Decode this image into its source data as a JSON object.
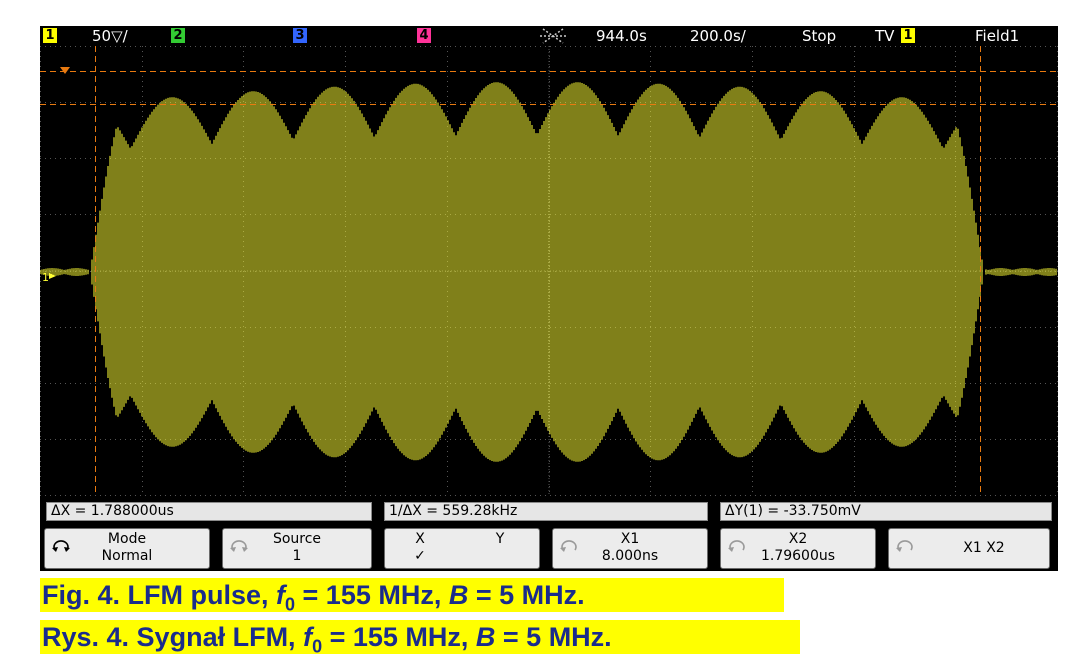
{
  "topbar": {
    "ch1_num": "1",
    "ch1_scale": "50▽/",
    "ch2_num": "2",
    "ch3_num": "3",
    "ch4_num": "4",
    "delay": "944.0s",
    "timebase": "200.0s/",
    "run_state": "Stop",
    "trigger_mode": "TV",
    "trigger_source": "1",
    "trigger_field": "Field1"
  },
  "display": {
    "ground_marker": "1",
    "trace_color": "#ffff33",
    "grid_color": "#555555",
    "cursor_color": "#e87a10"
  },
  "measurements": {
    "delta_x": "ΔX = 1.788000us",
    "inv_delta_x": "1/ΔX = 559.28kHz",
    "delta_y": "ΔY(1) = -33.750mV"
  },
  "softkeys": {
    "mode_label": "Mode",
    "mode_value": "Normal",
    "source_label": "Source",
    "source_value": "1",
    "x_label": "X",
    "x_check": "✓",
    "y_label": "Y",
    "x1_label": "X1",
    "x1_value": "8.000ns",
    "x2_label": "X2",
    "x2_value": "1.79600us",
    "x1x2_label": "X1 X2"
  },
  "caption": {
    "en_prefix": "Fig. 4. LFM pulse, ",
    "f_symbol": "f",
    "f_sub": "0",
    "en_f_value": " = 155 MHz, ",
    "b_symbol": "B",
    "en_b_value": " = 5 MHz.",
    "pl_prefix": "Rys. 4. Sygnał LFM, ",
    "pl_f_value": " = 155 MHz, ",
    "pl_b_value": " = 5 MHz."
  }
}
